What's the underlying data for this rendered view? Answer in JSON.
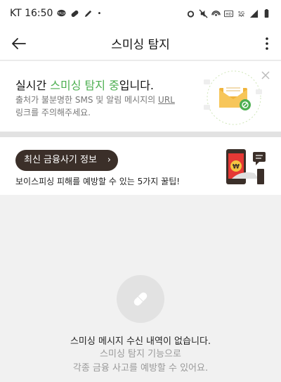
{
  "status_bar": {
    "carrier_time": "KT 16:50",
    "icons": [
      "talk-icon",
      "pill-icon",
      "edit-icon",
      "dot-icon",
      "alarm-icon",
      "mute-icon",
      "hotspot-icon",
      "hd-icon",
      "5g-icon",
      "signal-icon",
      "battery-icon"
    ]
  },
  "app_bar": {
    "title": "스미싱 탐지"
  },
  "banner": {
    "headline_pre": "실시간 ",
    "headline_accent": "스미싱 탐지 중",
    "headline_post": "입니다.",
    "desc_pre": "출처가 불분명한 SMS 및 알림 메시지의 ",
    "desc_url": "URL",
    "desc_post": "링크를 주의해주세요.",
    "accent_color": "#4caf50"
  },
  "info_card": {
    "pill_label": "최신 금융사기 정보",
    "pill_chevron": "›",
    "description": "보이스피싱 피해를 예방할 수 있는 5가지 꿀팁!",
    "pill_color": "#3b2f29"
  },
  "empty_state": {
    "title": "스미싱 메시지 수신 내역이 없습니다.",
    "subtitle_line1": "스미싱 탐지 기능으로",
    "subtitle_line2": "각종 금융 사고를 예방할 수 있어요."
  }
}
